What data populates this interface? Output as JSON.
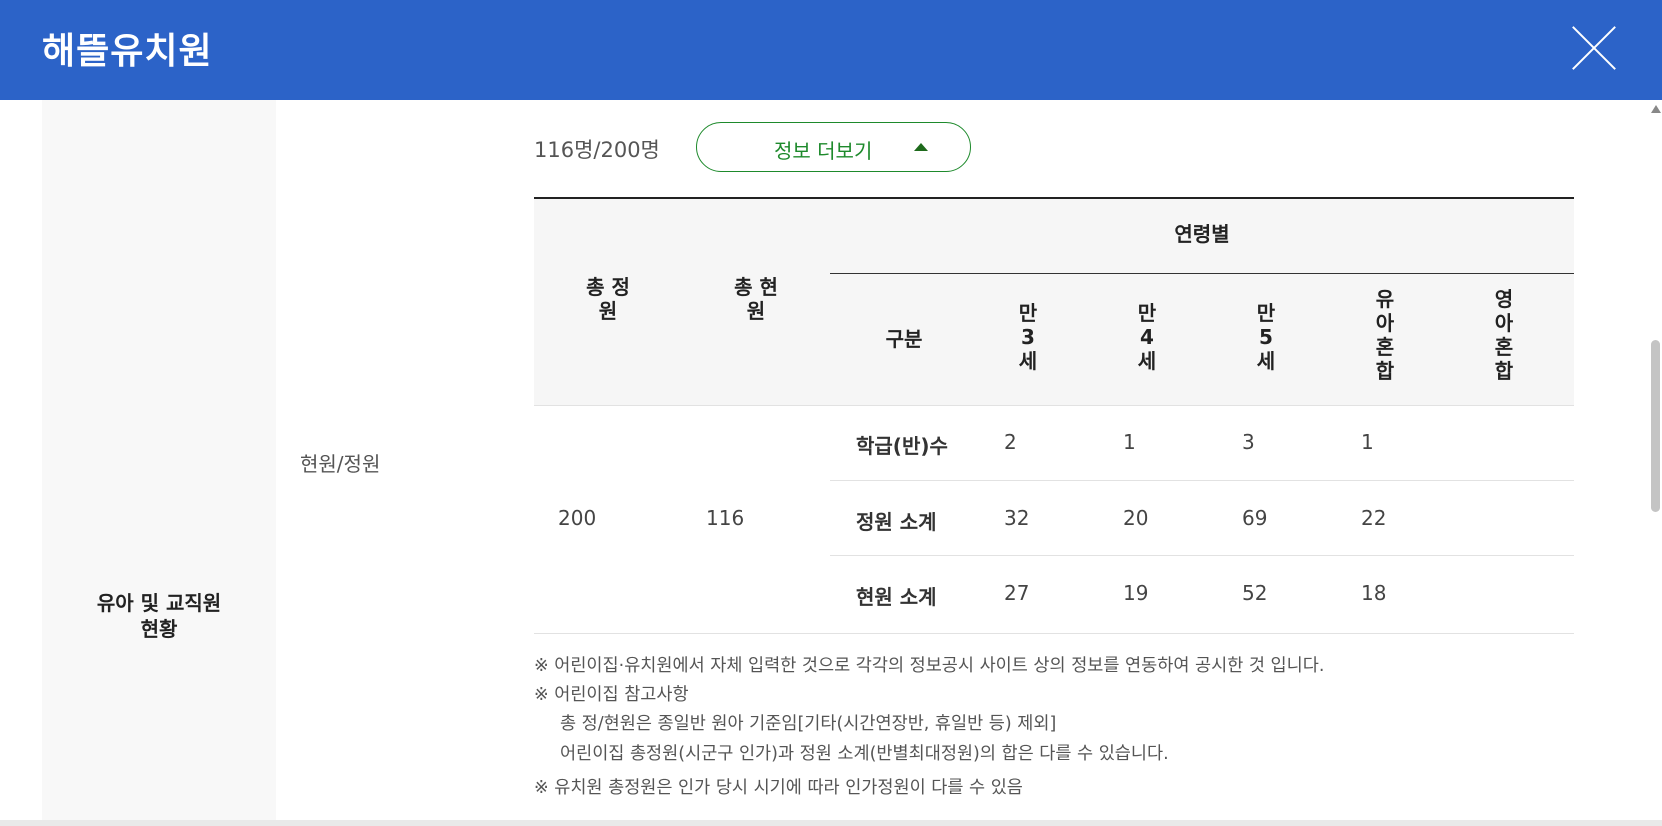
{
  "header": {
    "title": "해뜰유치원"
  },
  "section": {
    "left_label_line1": "유아 및 교직원",
    "left_label_line2": "현황",
    "mid_label": "현원/정원"
  },
  "summary": {
    "count_text": "116명/200명",
    "more_button": "정보 더보기"
  },
  "table": {
    "headers": {
      "total_capacity": [
        "총 정",
        "원"
      ],
      "total_current": [
        "총 현",
        "원"
      ],
      "by_age": "연령별",
      "category": "구분",
      "age_cols": [
        [
          "만",
          "3",
          "세"
        ],
        [
          "만",
          "4",
          "세"
        ],
        [
          "만",
          "5",
          "세"
        ],
        [
          "유",
          "아",
          "혼",
          "합"
        ],
        [
          "영",
          "아",
          "혼",
          "합"
        ]
      ]
    },
    "total_capacity": "200",
    "total_current": "116",
    "rows": [
      {
        "label": "학급(반)수",
        "values": [
          "2",
          "1",
          "3",
          "1",
          ""
        ]
      },
      {
        "label": "정원 소계",
        "values": [
          "32",
          "20",
          "69",
          "22",
          ""
        ]
      },
      {
        "label": "현원 소계",
        "values": [
          "27",
          "19",
          "52",
          "18",
          ""
        ]
      }
    ]
  },
  "notes": [
    "※ 어린이집·유치원에서 자체 입력한 것으로 각각의 정보공시 사이트 상의 정보를 연동하여 공시한 것 입니다.",
    "※ 어린이집 참고사항",
    "총 정/현원은 종일반 원아 기준임[기타(시간연장반, 휴일반 등) 제외]",
    "어린이집 총정원(시군구 인가)과 정원 소계(반별최대정원)의 합은 다를 수 있습니다.",
    "※ 유치원 총정원은 인가 당시 시기에 따라 인가정원이 다를 수 있음"
  ]
}
